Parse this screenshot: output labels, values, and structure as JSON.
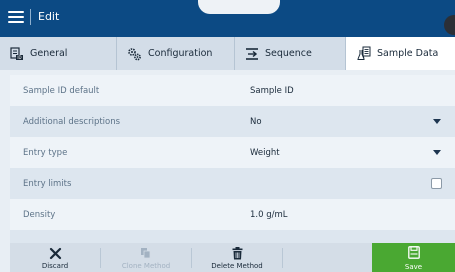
{
  "header": {
    "title": "Edit"
  },
  "tabs": [
    {
      "label": "General",
      "icon": "general-settings-icon"
    },
    {
      "label": "Configuration",
      "icon": "gears-icon"
    },
    {
      "label": "Sequence",
      "icon": "sequence-icon"
    },
    {
      "label": "Sample Data",
      "icon": "sample-data-icon",
      "active": true
    }
  ],
  "rows": [
    {
      "label": "Sample ID default",
      "value": "Sample ID"
    },
    {
      "label": "Additional descriptions",
      "value": "No",
      "control": "dropdown"
    },
    {
      "label": "Entry type",
      "value": "Weight",
      "control": "dropdown"
    },
    {
      "label": "Entry limits",
      "value": "",
      "control": "checkbox",
      "checked": false
    },
    {
      "label": "Density",
      "value": "1.0 g/mL"
    }
  ],
  "toolbar": {
    "discard": "Discard",
    "clone_method": "Clone Method",
    "delete_method": "Delete Method",
    "save": "Save"
  },
  "colors": {
    "header_bg": "#0c4a84",
    "save_bg": "#4aa832",
    "active_tab_bg": "#ffffff"
  }
}
